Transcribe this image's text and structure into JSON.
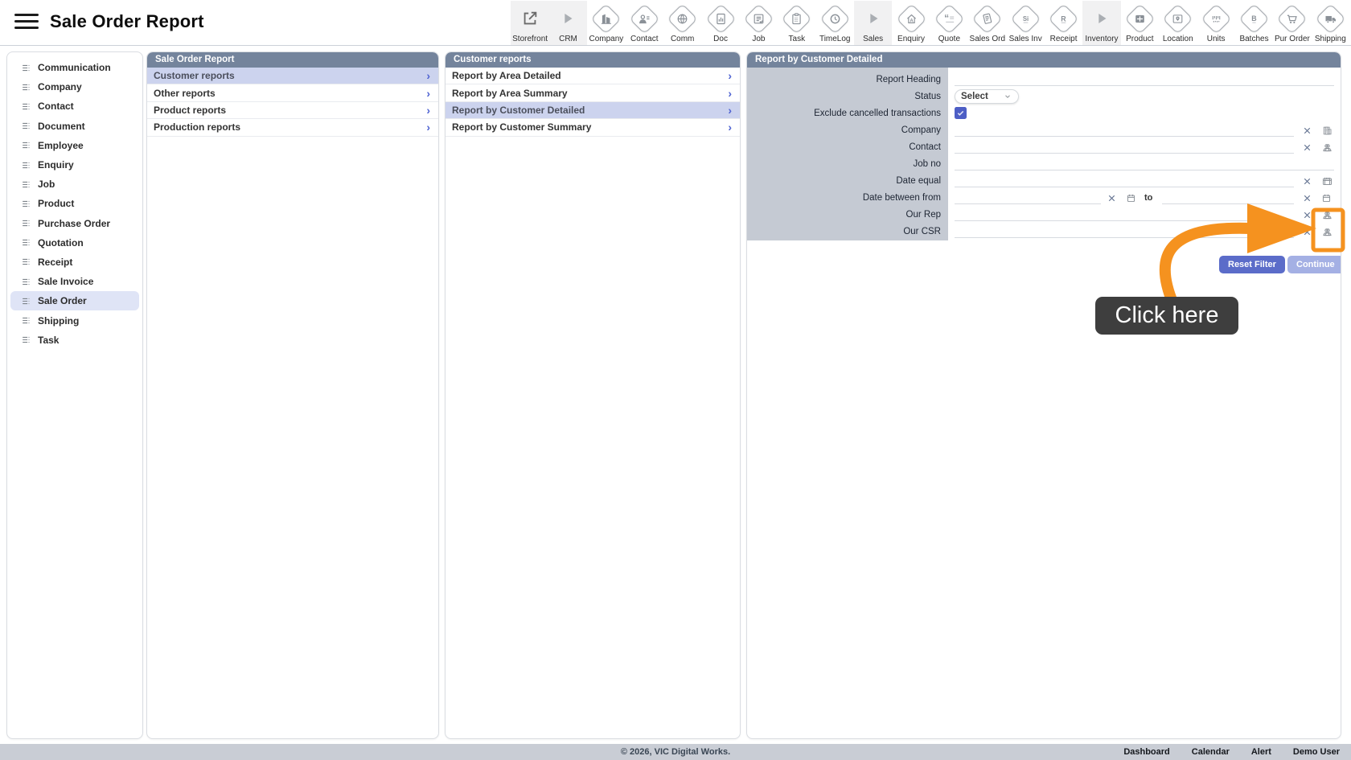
{
  "header": {
    "title": "Sale Order Report"
  },
  "toolbar": {
    "items": [
      {
        "label": "Storefront",
        "icon": "external-link-icon",
        "kind": "action",
        "shaded": true
      },
      {
        "label": "CRM",
        "icon": "play-icon",
        "kind": "group",
        "shaded": true
      },
      {
        "label": "Company",
        "icon": "company-icon"
      },
      {
        "label": "Contact",
        "icon": "contact-card-icon"
      },
      {
        "label": "Comm",
        "icon": "globe-icon"
      },
      {
        "label": "Doc",
        "icon": "doc-chart-icon"
      },
      {
        "label": "Job",
        "icon": "job-list-icon"
      },
      {
        "label": "Task",
        "icon": "clipboard-icon"
      },
      {
        "label": "TimeLog",
        "icon": "clock-icon"
      },
      {
        "label": "Sales",
        "icon": "play-icon",
        "kind": "group",
        "shaded": true
      },
      {
        "label": "Enquiry",
        "icon": "enquiry-house-icon"
      },
      {
        "label": "Quote",
        "icon": "quote-icon"
      },
      {
        "label": "Sales Ord",
        "icon": "sales-order-doc-icon"
      },
      {
        "label": "Sales Inv",
        "icon": "si-letter-icon"
      },
      {
        "label": "Receipt",
        "icon": "r-letter-icon"
      },
      {
        "label": "Inventory",
        "icon": "play-icon",
        "kind": "group",
        "shaded": true
      },
      {
        "label": "Product",
        "icon": "product-grid-icon"
      },
      {
        "label": "Location",
        "icon": "map-pin-icon"
      },
      {
        "label": "Units",
        "icon": "barcode-icon"
      },
      {
        "label": "Batches",
        "icon": "b-letter-icon"
      },
      {
        "label": "Pur Order",
        "icon": "cart-icon"
      },
      {
        "label": "Shipping",
        "icon": "truck-icon"
      }
    ]
  },
  "sidebar": {
    "items": [
      {
        "label": "Communication"
      },
      {
        "label": "Company"
      },
      {
        "label": "Contact"
      },
      {
        "label": "Document"
      },
      {
        "label": "Employee"
      },
      {
        "label": "Enquiry"
      },
      {
        "label": "Job"
      },
      {
        "label": "Product"
      },
      {
        "label": "Purchase Order"
      },
      {
        "label": "Quotation"
      },
      {
        "label": "Receipt"
      },
      {
        "label": "Sale Invoice"
      },
      {
        "label": "Sale Order",
        "selected": true
      },
      {
        "label": "Shipping"
      },
      {
        "label": "Task"
      }
    ]
  },
  "panels": {
    "level1": {
      "title": "Sale Order Report",
      "items": [
        {
          "label": "Customer reports",
          "selected": true
        },
        {
          "label": "Other reports"
        },
        {
          "label": "Product reports"
        },
        {
          "label": "Production reports"
        }
      ]
    },
    "level2": {
      "title": "Customer reports",
      "items": [
        {
          "label": "Report by Area Detailed"
        },
        {
          "label": "Report by Area Summary"
        },
        {
          "label": "Report by Customer Detailed",
          "selected": true
        },
        {
          "label": "Report by Customer Summary"
        }
      ]
    },
    "detail": {
      "title": "Report by Customer Detailed",
      "rows": [
        {
          "label": "Report Heading",
          "type": "text",
          "value": ""
        },
        {
          "label": "Status",
          "type": "select",
          "value": "Select"
        },
        {
          "label": "Exclude cancelled transactions",
          "type": "checkbox",
          "checked": true
        },
        {
          "label": "Company",
          "type": "text",
          "value": "",
          "icons": [
            "clear",
            "company"
          ]
        },
        {
          "label": "Contact",
          "type": "text",
          "value": "",
          "icons": [
            "clear",
            "person"
          ]
        },
        {
          "label": "Job no",
          "type": "text",
          "value": ""
        },
        {
          "label": "Date equal",
          "type": "text",
          "value": "",
          "icons": [
            "clear",
            "calendar"
          ]
        },
        {
          "label": "Date between from",
          "type": "daterange",
          "value_from": "",
          "value_to": "",
          "separator_label": "to",
          "icons": [
            "clear",
            "calendar"
          ]
        },
        {
          "label": "Our Rep",
          "type": "text",
          "value": "",
          "icons": [
            "clear",
            "person"
          ]
        },
        {
          "label": "Our CSR",
          "type": "text",
          "value": "",
          "icons": [
            "clear",
            "person"
          ],
          "highlighted": true
        }
      ],
      "buttons": [
        {
          "label": "Reset Filter"
        },
        {
          "label": "Continue"
        }
      ]
    }
  },
  "annotation": {
    "tooltip_label": "Click here",
    "target": "our-csr-person-picker-icon",
    "arrow_color": "#F5921F",
    "tooltip_bg": "#3E3E3E"
  },
  "footer": {
    "copyright": "© 2026, VIC Digital Works.",
    "links": [
      "Dashboard",
      "Calendar",
      "Alert",
      "Demo User"
    ]
  },
  "colors": {
    "panel_header_bg": "#74849C",
    "selected_row_bg": "#CCD3EE",
    "sidebar_selected_bg": "#DFE4F6",
    "label_column_bg": "#C5CAD3",
    "checkbox_bg": "#4D5EC5",
    "reset_button_bg": "#5B6CC9",
    "continue_button_bg": "#A4B0E4",
    "footer_bg": "#C9CDD5",
    "chevron_blue": "#4F63D2",
    "accent_orange": "#F5921F"
  }
}
